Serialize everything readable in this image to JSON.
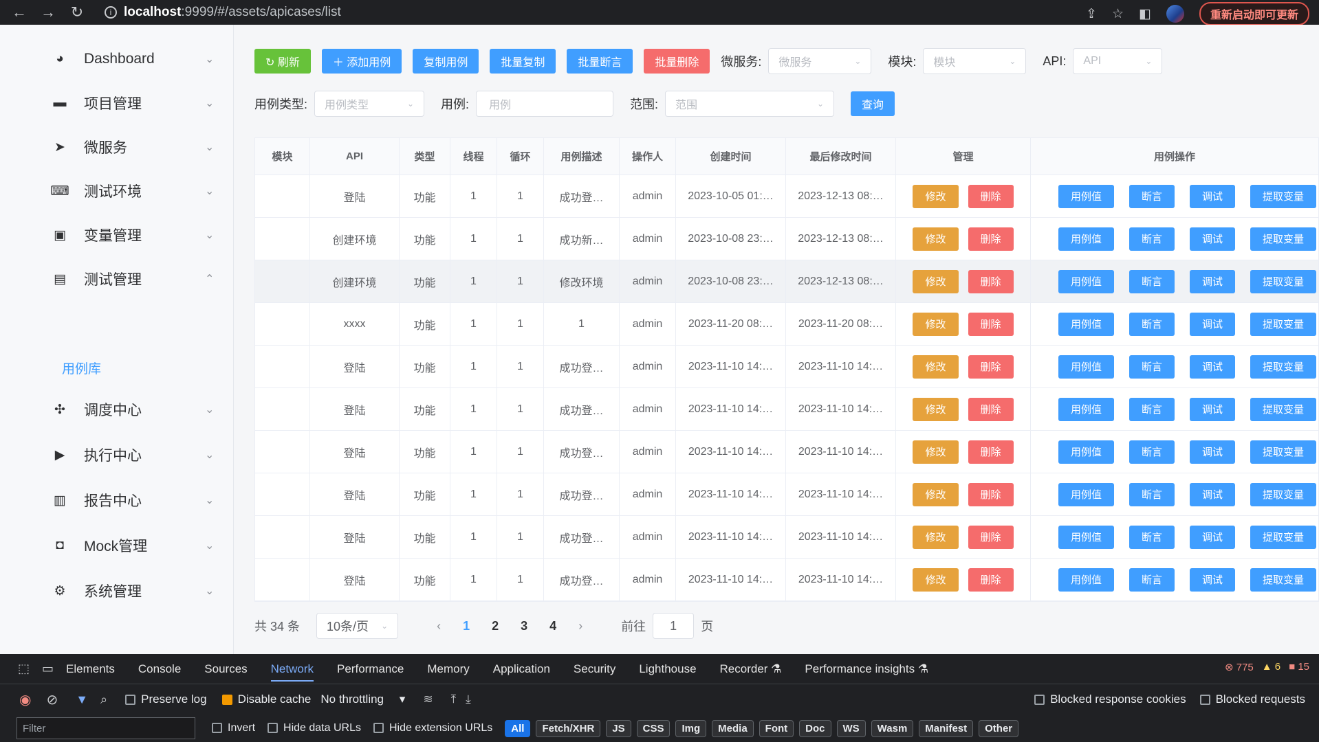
{
  "browser": {
    "url_host": "localhost",
    "url_path": ":9999/#/assets/apicases/list",
    "update_label": "重新启动即可更新"
  },
  "sidebar": {
    "items": [
      {
        "label": "Dashboard",
        "icon": "dashboard-icon",
        "arrow": "⌄"
      },
      {
        "label": "项目管理",
        "icon": "folder-icon",
        "arrow": "⌄"
      },
      {
        "label": "微服务",
        "icon": "send-icon",
        "arrow": "⌄"
      },
      {
        "label": "测试环境",
        "icon": "code-icon",
        "arrow": "⌄"
      },
      {
        "label": "变量管理",
        "icon": "variable-icon",
        "arrow": "⌄"
      },
      {
        "label": "测试管理",
        "icon": "calendar-icon",
        "arrow": "⌃"
      },
      {
        "label": "调度中心",
        "icon": "dispatch-icon",
        "arrow": "⌄"
      },
      {
        "label": "执行中心",
        "icon": "play-icon",
        "arrow": "⌄"
      },
      {
        "label": "报告中心",
        "icon": "report-icon",
        "arrow": "⌄"
      },
      {
        "label": "Mock管理",
        "icon": "mock-icon",
        "arrow": "⌄"
      },
      {
        "label": "系统管理",
        "icon": "gear-icon",
        "arrow": "⌄"
      }
    ],
    "sub_item": "用例库"
  },
  "toolbar": {
    "refresh": "↻ 刷新",
    "add": "＋ 添加用例",
    "copy": "复制用例",
    "batch_copy": "批量复制",
    "batch_assert": "批量断言",
    "batch_delete": "批量删除",
    "microservice_label": "微服务:",
    "microservice_placeholder": "微服务",
    "module_label": "模块:",
    "module_placeholder": "模块",
    "api_label": "API:",
    "api_placeholder": "API"
  },
  "filters": {
    "case_type_label": "用例类型:",
    "case_type_placeholder": "用例类型",
    "case_label": "用例:",
    "case_placeholder": "用例",
    "scope_label": "范围:",
    "scope_placeholder": "范围",
    "query": "查询"
  },
  "table": {
    "headers": [
      "模块",
      "API",
      "类型",
      "线程",
      "循环",
      "用例描述",
      "操作人",
      "创建时间",
      "最后修改时间",
      "管理",
      "用例操作"
    ],
    "manage_buttons": {
      "edit": "修改",
      "delete": "删除"
    },
    "action_buttons": {
      "value": "用例值",
      "assert": "断言",
      "debug": "调试",
      "extract": "提取变量"
    },
    "rows": [
      {
        "module": "",
        "api": "登陆",
        "type": "功能",
        "threads": "1",
        "loops": "1",
        "desc": "成功登…",
        "operator": "admin",
        "created": "2023-10-05 01:…",
        "modified": "2023-12-13 08:…"
      },
      {
        "module": "",
        "api": "创建环境",
        "type": "功能",
        "threads": "1",
        "loops": "1",
        "desc": "成功新…",
        "operator": "admin",
        "created": "2023-10-08 23:…",
        "modified": "2023-12-13 08:…"
      },
      {
        "module": "",
        "api": "创建环境",
        "type": "功能",
        "threads": "1",
        "loops": "1",
        "desc": "修改环境",
        "operator": "admin",
        "created": "2023-10-08 23:…",
        "modified": "2023-12-13 08:…"
      },
      {
        "module": "",
        "api": "xxxx",
        "type": "功能",
        "threads": "1",
        "loops": "1",
        "desc": "1",
        "operator": "admin",
        "created": "2023-11-20 08:…",
        "modified": "2023-11-20 08:…"
      },
      {
        "module": "",
        "api": "登陆",
        "type": "功能",
        "threads": "1",
        "loops": "1",
        "desc": "成功登…",
        "operator": "admin",
        "created": "2023-11-10 14:…",
        "modified": "2023-11-10 14:…"
      },
      {
        "module": "",
        "api": "登陆",
        "type": "功能",
        "threads": "1",
        "loops": "1",
        "desc": "成功登…",
        "operator": "admin",
        "created": "2023-11-10 14:…",
        "modified": "2023-11-10 14:…"
      },
      {
        "module": "",
        "api": "登陆",
        "type": "功能",
        "threads": "1",
        "loops": "1",
        "desc": "成功登…",
        "operator": "admin",
        "created": "2023-11-10 14:…",
        "modified": "2023-11-10 14:…"
      },
      {
        "module": "",
        "api": "登陆",
        "type": "功能",
        "threads": "1",
        "loops": "1",
        "desc": "成功登…",
        "operator": "admin",
        "created": "2023-11-10 14:…",
        "modified": "2023-11-10 14:…"
      },
      {
        "module": "",
        "api": "登陆",
        "type": "功能",
        "threads": "1",
        "loops": "1",
        "desc": "成功登…",
        "operator": "admin",
        "created": "2023-11-10 14:…",
        "modified": "2023-11-10 14:…"
      },
      {
        "module": "",
        "api": "登陆",
        "type": "功能",
        "threads": "1",
        "loops": "1",
        "desc": "成功登…",
        "operator": "admin",
        "created": "2023-11-10 14:…",
        "modified": "2023-11-10 14:…"
      }
    ]
  },
  "pagination": {
    "total": "共 34 条",
    "page_size": "10条/页",
    "pages": [
      "1",
      "2",
      "3",
      "4"
    ],
    "prev": "‹",
    "next": "›",
    "goto_label": "前往",
    "goto_value": "1",
    "page_suffix": "页"
  },
  "devtools": {
    "tabs": [
      "Elements",
      "Console",
      "Sources",
      "Network",
      "Performance",
      "Memory",
      "Application",
      "Security",
      "Lighthouse",
      "Recorder ⚗",
      "Performance insights ⚗"
    ],
    "errors": "775",
    "warnings": "6",
    "issues": "15",
    "preserve_log": "Preserve log",
    "disable_cache": "Disable cache",
    "throttling": "No throttling",
    "blocked_cookies": "Blocked response cookies",
    "blocked_requests": "Blocked requests",
    "filter_placeholder": "Filter",
    "invert": "Invert",
    "hide_data_urls": "Hide data URLs",
    "hide_extension_urls": "Hide extension URLs",
    "type_filters": [
      "All",
      "Fetch/XHR",
      "JS",
      "CSS",
      "Img",
      "Media",
      "Font",
      "Doc",
      "WS",
      "Wasm",
      "Manifest",
      "Other"
    ]
  }
}
